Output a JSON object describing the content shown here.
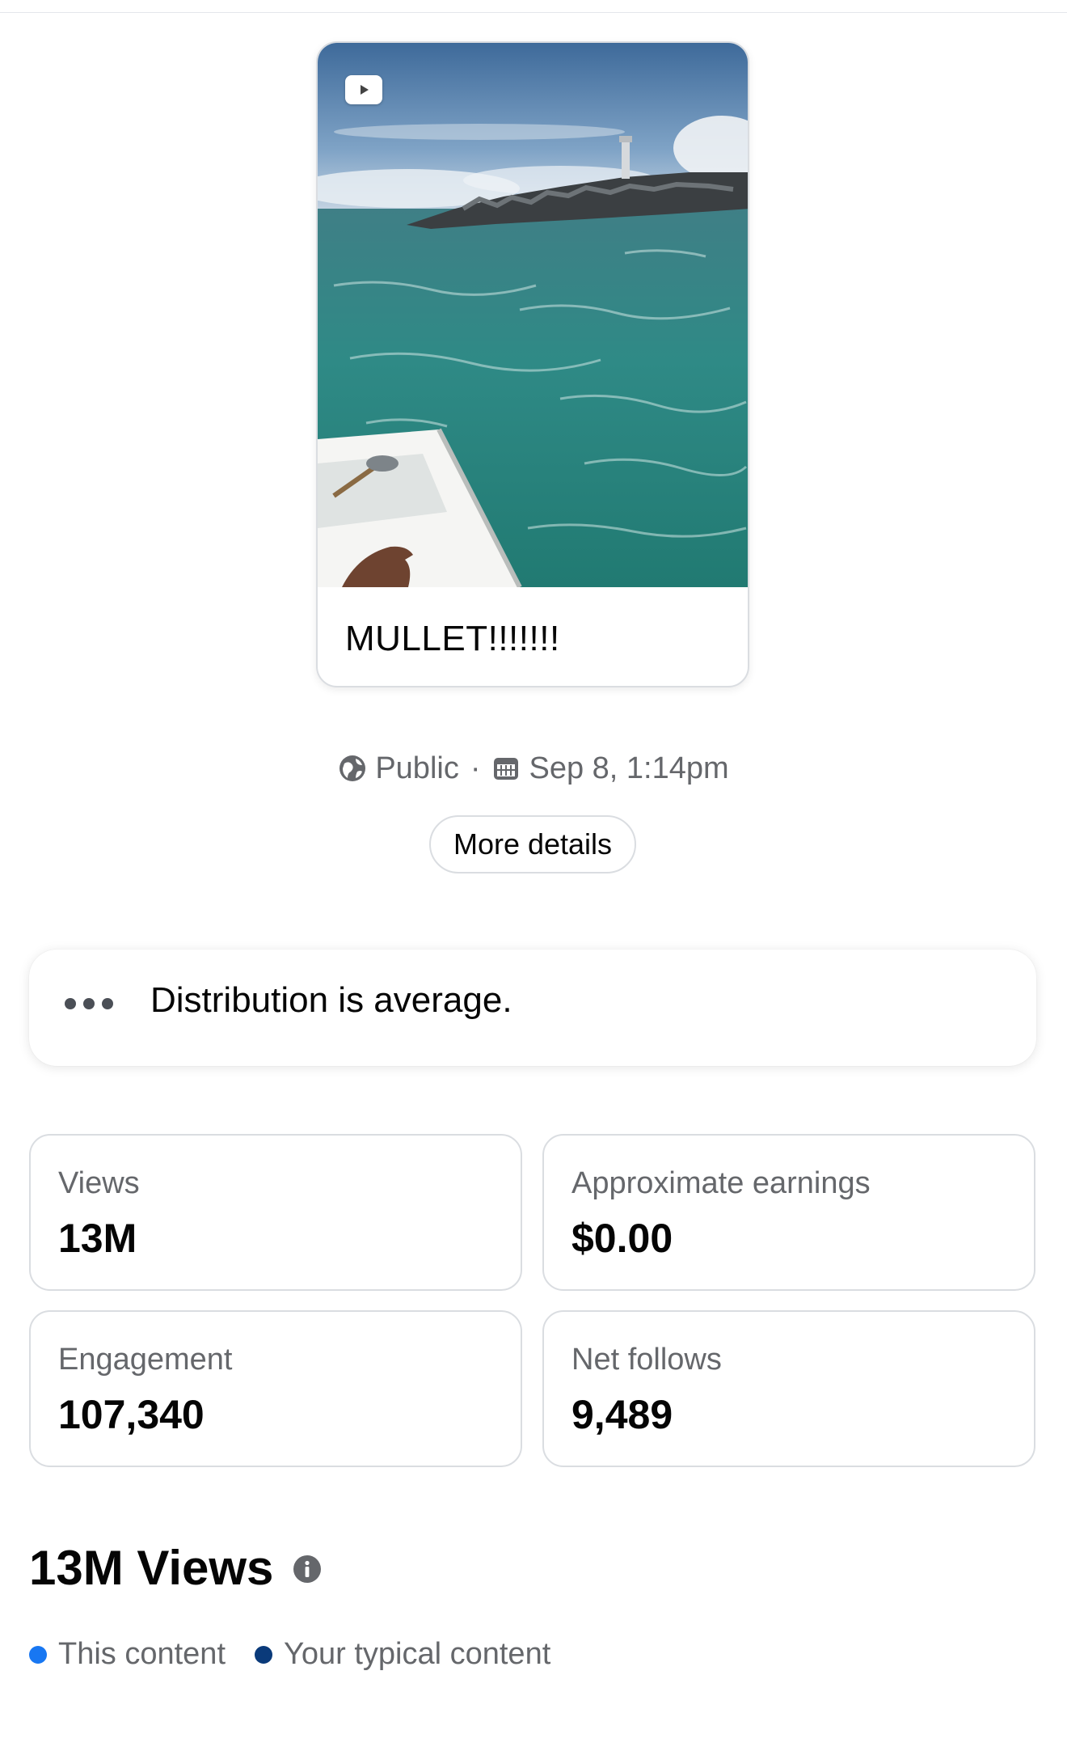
{
  "post": {
    "caption": "MULLET!!!!!!!",
    "thumbnail_icon": "video-play-icon"
  },
  "meta": {
    "audience_icon": "globe-icon",
    "audience": "Public",
    "separator": "·",
    "date_icon": "calendar-icon",
    "date": "Sep 8, 1:14pm"
  },
  "more_details_label": "More details",
  "distribution": {
    "icon": "more-dots-icon",
    "text": "Distribution is average."
  },
  "stats": [
    {
      "label": "Views",
      "value": "13M"
    },
    {
      "label": "Approximate earnings",
      "value": "$0.00"
    },
    {
      "label": "Engagement",
      "value": "107,340"
    },
    {
      "label": "Net follows",
      "value": "9,489"
    }
  ],
  "views_section": {
    "title": "13M Views",
    "info_icon": "info-icon"
  },
  "legend": [
    {
      "label": "This content",
      "color": "#1877f2"
    },
    {
      "label": "Your typical content",
      "color": "#0a3a7a"
    }
  ]
}
